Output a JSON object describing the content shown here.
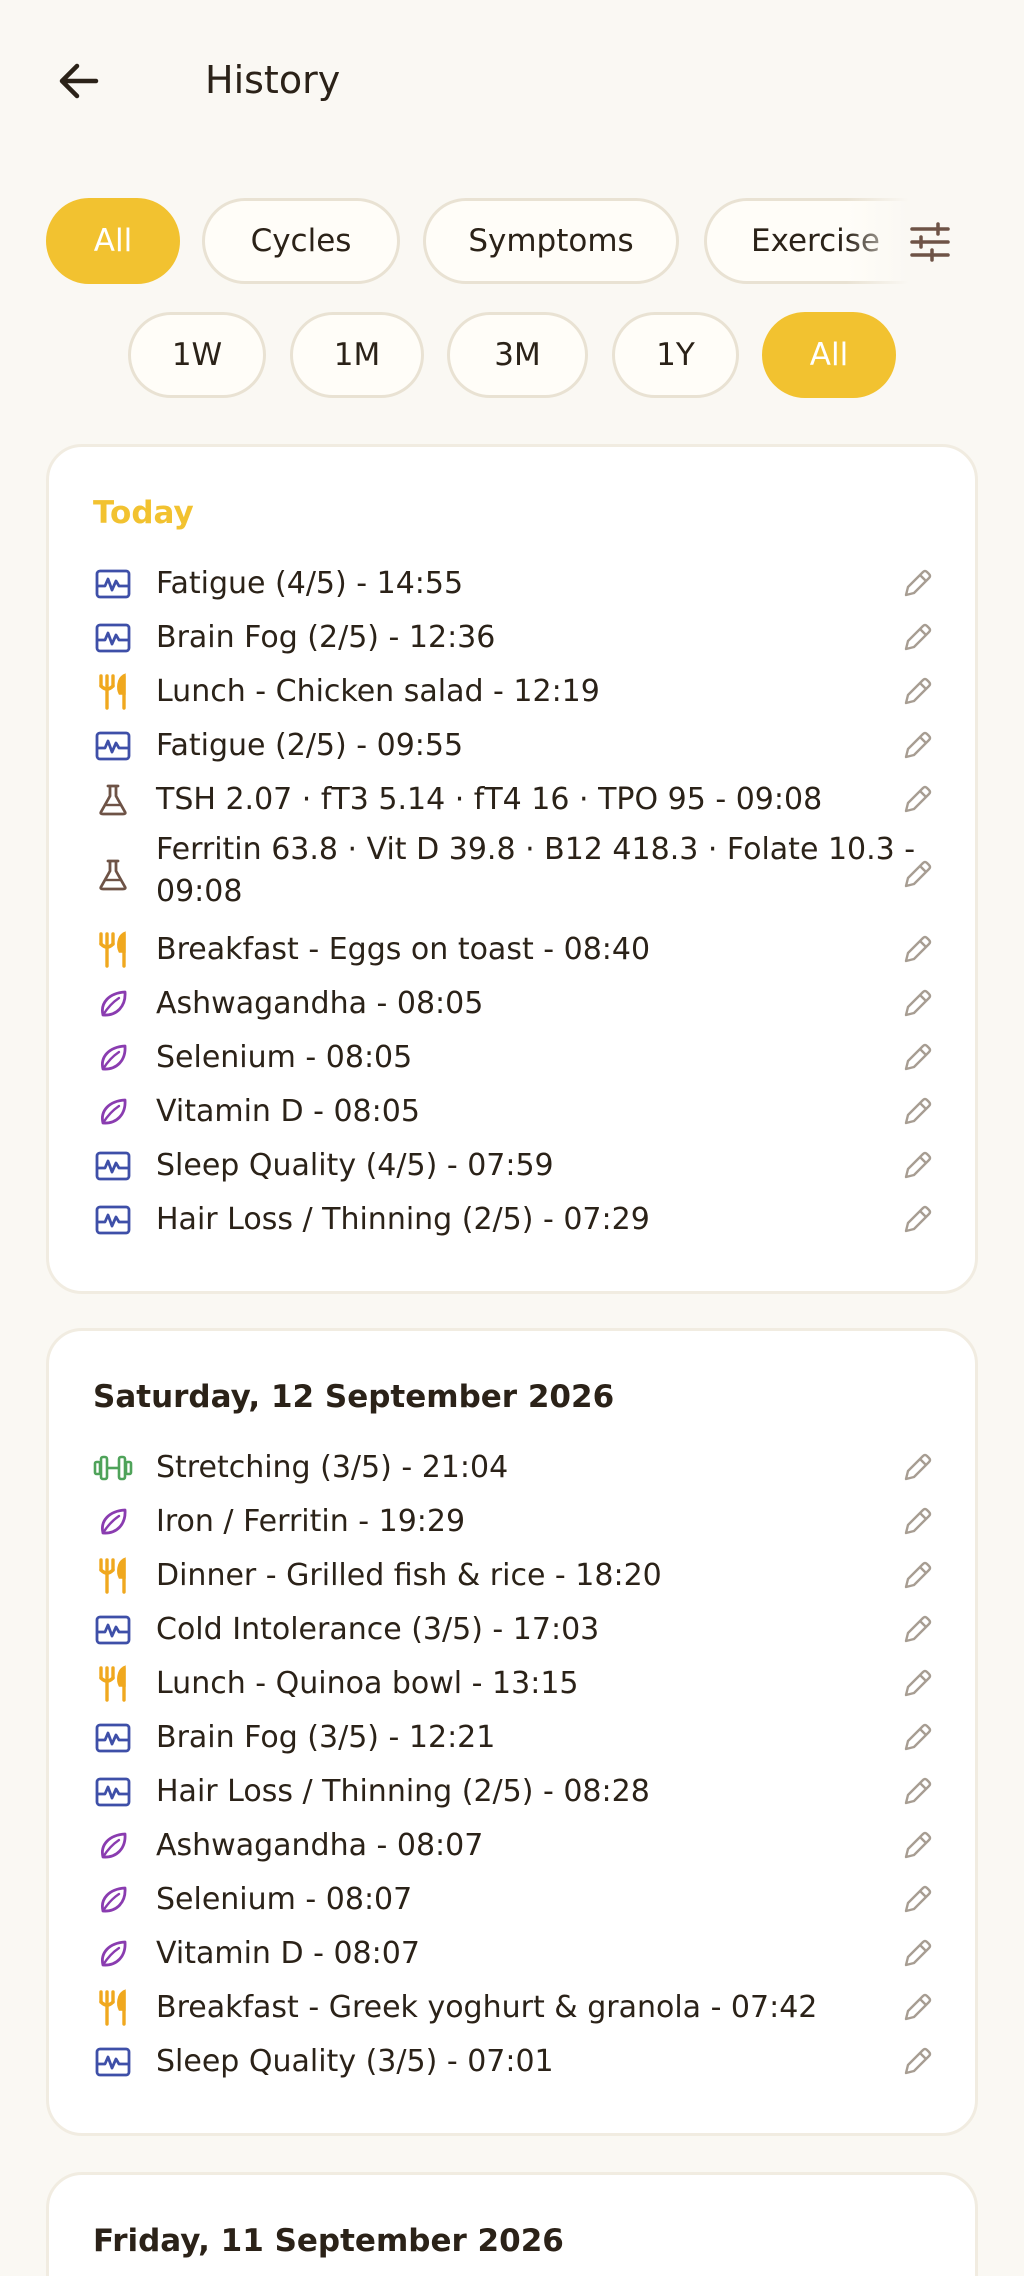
{
  "header": {
    "title": "History"
  },
  "categories": [
    "All",
    "Cycles",
    "Symptoms",
    "Exercise"
  ],
  "ranges": [
    "1W",
    "1M",
    "3M",
    "1Y",
    "All"
  ],
  "colors": {
    "accent": "#f2c230",
    "symptom": "#3e4fa8",
    "meal": "#f0a81e",
    "lab": "#6e5346",
    "supplement": "#8a3cb0",
    "exercise": "#4fa35a"
  },
  "sections": [
    {
      "title": "Today",
      "entries": [
        {
          "icon": "symptom-icon",
          "text": "Fatigue (4/5) - 14:55"
        },
        {
          "icon": "meal-icon",
          "text": "Brain Fog (2/5) - 12:36",
          "iconOverride": "symptom-icon"
        },
        {
          "icon": "meal-icon",
          "text": "Lunch - Chicken salad - 12:19"
        },
        {
          "icon": "symptom-icon",
          "text": "Fatigue (2/5) - 09:55"
        },
        {
          "icon": "lab-icon",
          "text": "TSH 2.07 · fT3 5.14 · fT4 16 · TPO 95 - 09:08"
        },
        {
          "icon": "lab-icon",
          "text": "Ferritin 63.8 · Vit D 39.8 · B12 418.3 · Folate 10.3 - 09:08"
        },
        {
          "icon": "meal-icon",
          "text": "Breakfast - Eggs on toast - 08:40"
        },
        {
          "icon": "supplement-icon",
          "text": "Ashwagandha - 08:05"
        },
        {
          "icon": "supplement-icon",
          "text": "Selenium - 08:05"
        },
        {
          "icon": "supplement-icon",
          "text": "Vitamin D - 08:05"
        },
        {
          "icon": "symptom-icon",
          "text": "Sleep Quality (4/5) - 07:59"
        },
        {
          "icon": "symptom-icon",
          "text": "Hair Loss / Thinning (2/5) - 07:29"
        }
      ]
    },
    {
      "title": "Saturday, 12 September 2026",
      "entries": [
        {
          "icon": "exercise-icon",
          "text": "Stretching (3/5) - 21:04"
        },
        {
          "icon": "supplement-icon",
          "text": "Iron / Ferritin - 19:29"
        },
        {
          "icon": "meal-icon",
          "text": "Dinner - Grilled fish & rice - 18:20"
        },
        {
          "icon": "symptom-icon",
          "text": "Cold Intolerance (3/5) - 17:03"
        },
        {
          "icon": "meal-icon",
          "text": "Lunch - Quinoa bowl - 13:15"
        },
        {
          "icon": "symptom-icon",
          "text": "Brain Fog (3/5) - 12:21"
        },
        {
          "icon": "symptom-icon",
          "text": "Hair Loss / Thinning (2/5) - 08:28"
        },
        {
          "icon": "supplement-icon",
          "text": "Ashwagandha - 08:07"
        },
        {
          "icon": "supplement-icon",
          "text": "Selenium - 08:07"
        },
        {
          "icon": "supplement-icon",
          "text": "Vitamin D - 08:07"
        },
        {
          "icon": "meal-icon",
          "text": "Breakfast - Greek yoghurt & granola - 07:42"
        },
        {
          "icon": "symptom-icon",
          "text": "Sleep Quality (3/5) - 07:01"
        }
      ]
    },
    {
      "title": "Friday, 11 September 2026",
      "entries": []
    }
  ]
}
